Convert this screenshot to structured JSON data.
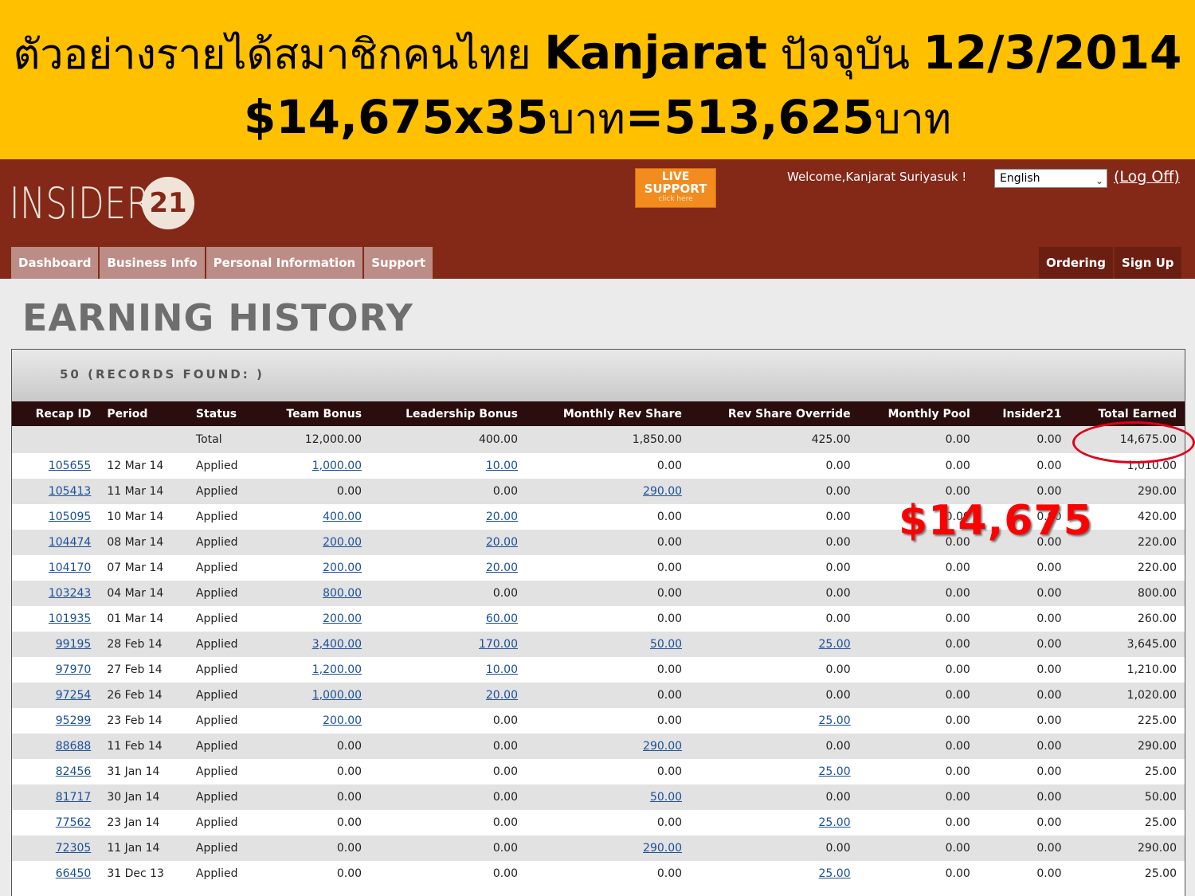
{
  "banner": {
    "line1_thai": "ตัวอย่างรายได้สมาชิกคนไทย",
    "line1_name": "Kanjarat",
    "line1_thai2": "ปัจจุบัน",
    "line1_date": "12/3/2014",
    "line2_amount": "$14,675x35",
    "line2_unit1": "บาท",
    "line2_result": "=513,625",
    "line2_unit2": "บาท"
  },
  "header": {
    "logo_text": "INSIDER",
    "logo_number": "21",
    "live_support": {
      "line1": "LIVE",
      "line2": "SUPPORT",
      "line3": "click here"
    },
    "welcome": "Welcome,Kanjarat Suriyasuk !",
    "language": "English",
    "logoff": "(Log Off)",
    "nav_left": [
      "Dashboard",
      "Business Info",
      "Personal Information",
      "Support"
    ],
    "nav_right": [
      "Ordering",
      "Sign Up"
    ]
  },
  "page_title": "EARNING HISTORY",
  "records_label": "50 (RECORDS FOUND: )",
  "table": {
    "columns": [
      "Recap ID",
      "Period",
      "Status",
      "Team Bonus",
      "Leadership Bonus",
      "Monthly Rev Share",
      "Rev Share Override",
      "Monthly Pool",
      "Insider21",
      "Total Earned"
    ],
    "total": [
      "",
      "",
      "Total",
      "12,000.00",
      "400.00",
      "1,850.00",
      "425.00",
      "0.00",
      "0.00",
      "14,675.00"
    ],
    "rows": [
      [
        "105655",
        "12 Mar 14",
        "Applied",
        "1,000.00",
        "10.00",
        "0.00",
        "0.00",
        "0.00",
        "0.00",
        "1,010.00"
      ],
      [
        "105413",
        "11 Mar 14",
        "Applied",
        "0.00",
        "0.00",
        "290.00",
        "0.00",
        "0.00",
        "0.00",
        "290.00"
      ],
      [
        "105095",
        "10 Mar 14",
        "Applied",
        "400.00",
        "20.00",
        "0.00",
        "0.00",
        "0.00",
        "0.00",
        "420.00"
      ],
      [
        "104474",
        "08 Mar 14",
        "Applied",
        "200.00",
        "20.00",
        "0.00",
        "0.00",
        "0.00",
        "0.00",
        "220.00"
      ],
      [
        "104170",
        "07 Mar 14",
        "Applied",
        "200.00",
        "20.00",
        "0.00",
        "0.00",
        "0.00",
        "0.00",
        "220.00"
      ],
      [
        "103243",
        "04 Mar 14",
        "Applied",
        "800.00",
        "0.00",
        "0.00",
        "0.00",
        "0.00",
        "0.00",
        "800.00"
      ],
      [
        "101935",
        "01 Mar 14",
        "Applied",
        "200.00",
        "60.00",
        "0.00",
        "0.00",
        "0.00",
        "0.00",
        "260.00"
      ],
      [
        "99195",
        "28 Feb 14",
        "Applied",
        "3,400.00",
        "170.00",
        "50.00",
        "25.00",
        "0.00",
        "0.00",
        "3,645.00"
      ],
      [
        "97970",
        "27 Feb 14",
        "Applied",
        "1,200.00",
        "10.00",
        "0.00",
        "0.00",
        "0.00",
        "0.00",
        "1,210.00"
      ],
      [
        "97254",
        "26 Feb 14",
        "Applied",
        "1,000.00",
        "20.00",
        "0.00",
        "0.00",
        "0.00",
        "0.00",
        "1,020.00"
      ],
      [
        "95299",
        "23 Feb 14",
        "Applied",
        "200.00",
        "0.00",
        "0.00",
        "25.00",
        "0.00",
        "0.00",
        "225.00"
      ],
      [
        "88688",
        "11 Feb 14",
        "Applied",
        "0.00",
        "0.00",
        "290.00",
        "0.00",
        "0.00",
        "0.00",
        "290.00"
      ],
      [
        "82456",
        "31 Jan 14",
        "Applied",
        "0.00",
        "0.00",
        "0.00",
        "25.00",
        "0.00",
        "0.00",
        "25.00"
      ],
      [
        "81717",
        "30 Jan 14",
        "Applied",
        "0.00",
        "0.00",
        "50.00",
        "0.00",
        "0.00",
        "0.00",
        "50.00"
      ],
      [
        "77562",
        "23 Jan 14",
        "Applied",
        "0.00",
        "0.00",
        "0.00",
        "25.00",
        "0.00",
        "0.00",
        "25.00"
      ],
      [
        "72305",
        "11 Jan 14",
        "Applied",
        "0.00",
        "0.00",
        "290.00",
        "0.00",
        "0.00",
        "0.00",
        "290.00"
      ],
      [
        "66450",
        "31 Dec 13",
        "Applied",
        "0.00",
        "0.00",
        "0.00",
        "25.00",
        "0.00",
        "0.00",
        "25.00"
      ]
    ]
  },
  "overlay_amount": "$14,675",
  "colors": {
    "banner": "#ffc000",
    "header": "#842818",
    "nav_left": "#bc8d86",
    "nav_right": "#6a1f12",
    "table_head": "#2b0d0d",
    "link": "#1a4f99",
    "highlight": "#ff0000"
  }
}
